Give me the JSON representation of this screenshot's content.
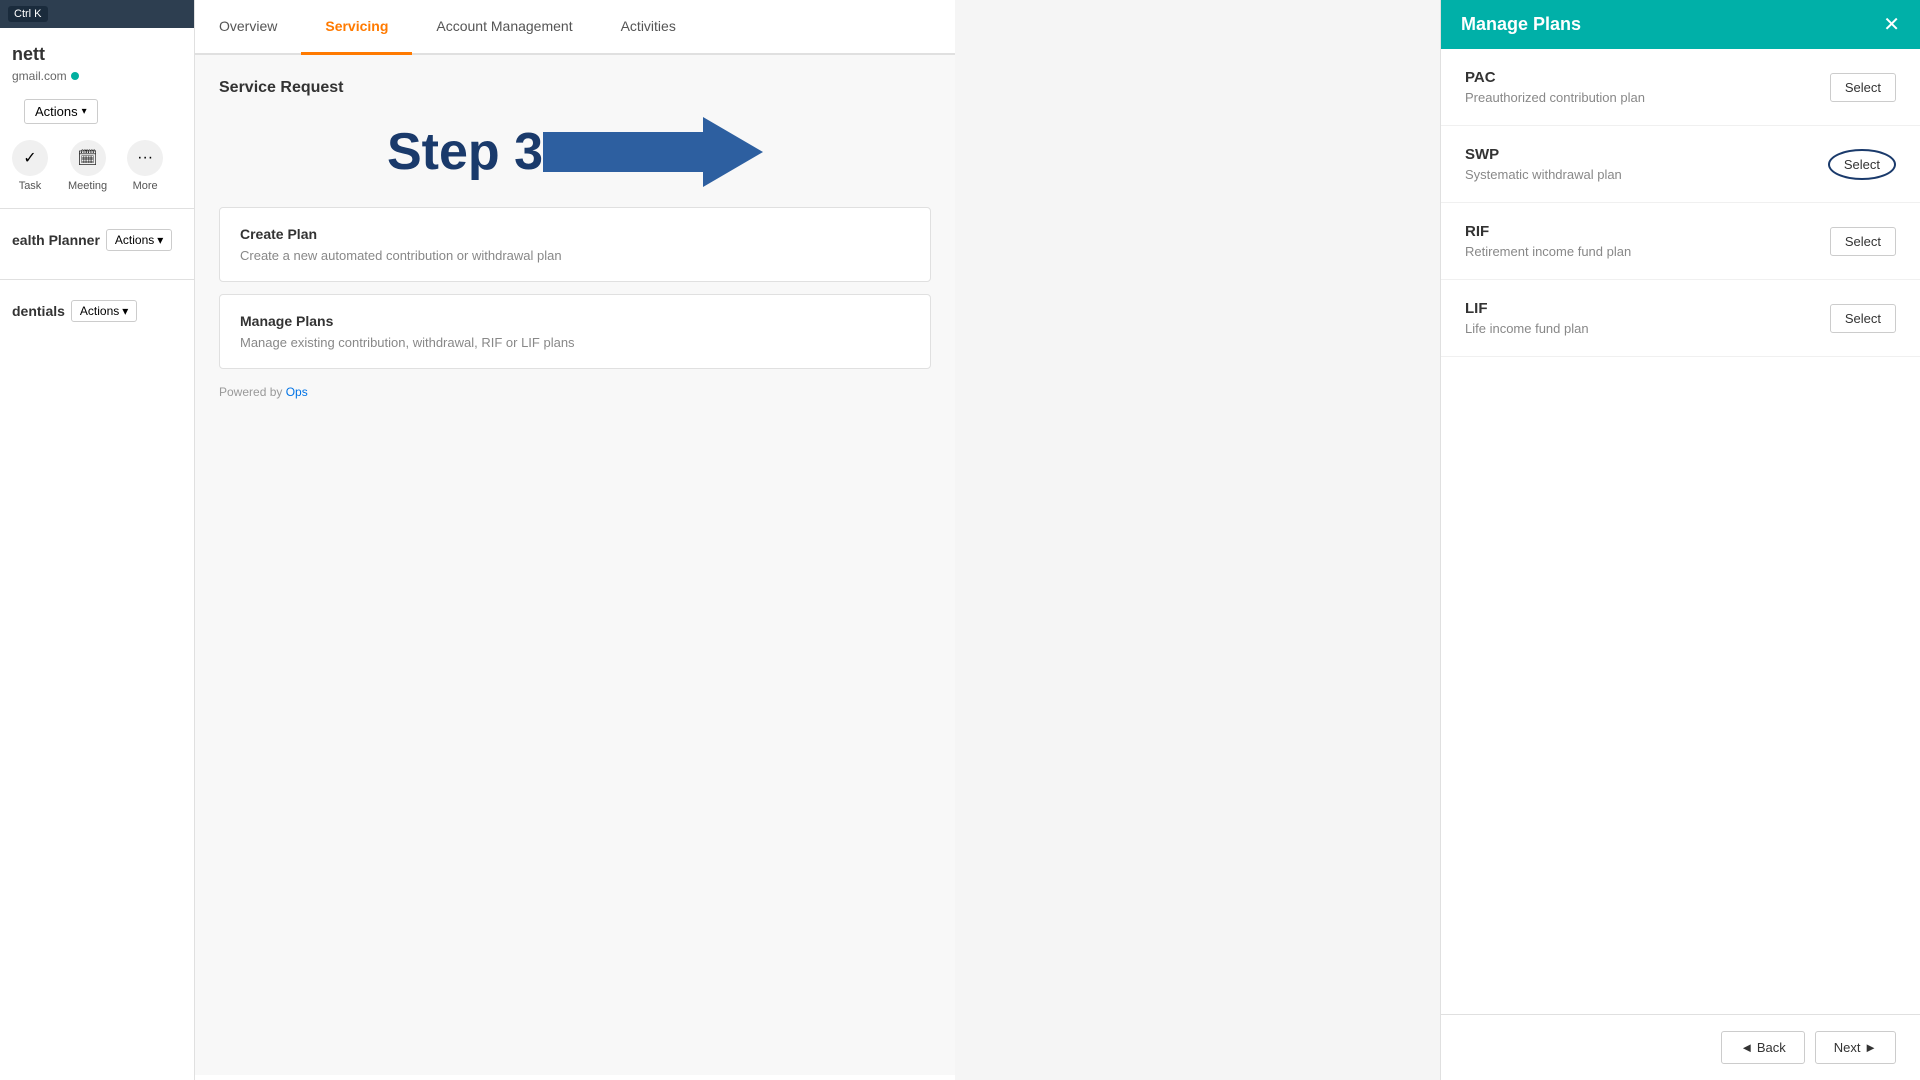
{
  "sidebar": {
    "top_bar_text": "Ctrl K",
    "name": "nett",
    "email": "gmail.com",
    "actions_label": "Actions",
    "icons": [
      {
        "id": "task",
        "label": "Task",
        "symbol": "✓"
      },
      {
        "id": "meeting",
        "label": "Meeting",
        "symbol": "📅"
      },
      {
        "id": "more",
        "label": "More",
        "symbol": "•••"
      }
    ],
    "sections": [
      {
        "id": "health-planner",
        "title": "ealth Planner",
        "actions_label": "Actions"
      },
      {
        "id": "credentials",
        "title": "dentials",
        "actions_label": "Actions"
      }
    ]
  },
  "tabs": [
    {
      "id": "overview",
      "label": "Overview",
      "active": false
    },
    {
      "id": "servicing",
      "label": "Servicing",
      "active": true
    },
    {
      "id": "account-management",
      "label": "Account Management",
      "active": false
    },
    {
      "id": "activities",
      "label": "Activities",
      "active": false
    }
  ],
  "main": {
    "section_title": "Service Request",
    "step_label": "Step 3",
    "cards": [
      {
        "id": "create-plan",
        "title": "Create Plan",
        "description": "Create a new automated contribution or withdrawal plan"
      },
      {
        "id": "manage-plans",
        "title": "Manage Plans",
        "description": "Manage existing contribution, withdrawal, RIF or LIF plans"
      }
    ],
    "powered_by": "Powered by",
    "powered_by_link": "Ops"
  },
  "manage_plans_panel": {
    "title": "Manage Plans",
    "close_symbol": "✕",
    "plans": [
      {
        "id": "pac",
        "code": "PAC",
        "description": "Preauthorized contribution plan",
        "select_label": "Select",
        "highlighted": false
      },
      {
        "id": "swp",
        "code": "SWP",
        "description": "Systematic withdrawal plan",
        "select_label": "Select",
        "highlighted": true
      },
      {
        "id": "rif",
        "code": "RIF",
        "description": "Retirement income fund plan",
        "select_label": "Select",
        "highlighted": false
      },
      {
        "id": "lif",
        "code": "LIF",
        "description": "Life income fund plan",
        "select_label": "Select",
        "highlighted": false
      }
    ],
    "footer": {
      "back_label": "◄ Back",
      "next_label": "Next ►"
    }
  },
  "colors": {
    "teal": "#00b0a8",
    "navy": "#1a3a6b",
    "orange": "#ff7a00",
    "arrow_fill": "#2d5fa0"
  }
}
